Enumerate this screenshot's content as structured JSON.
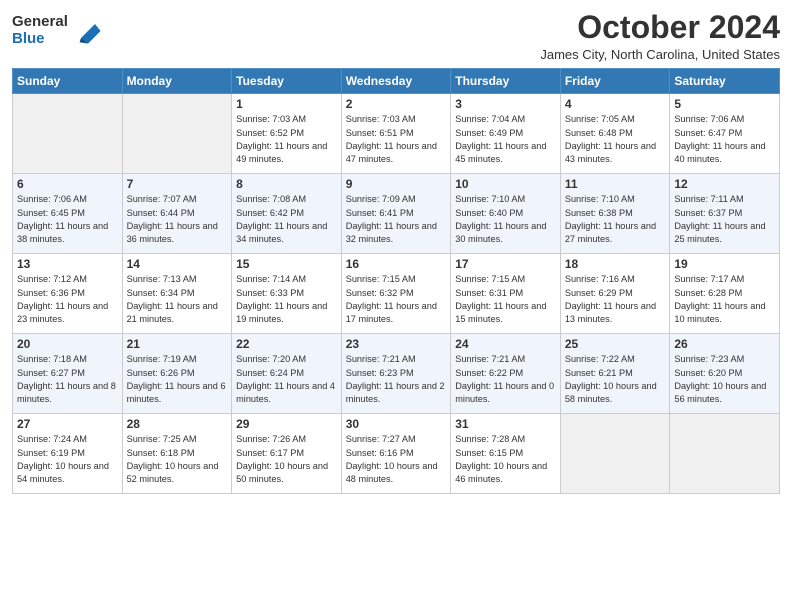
{
  "header": {
    "logo_line1": "General",
    "logo_line2": "Blue",
    "month": "October 2024",
    "location": "James City, North Carolina, United States"
  },
  "weekdays": [
    "Sunday",
    "Monday",
    "Tuesday",
    "Wednesday",
    "Thursday",
    "Friday",
    "Saturday"
  ],
  "weeks": [
    [
      {
        "day": "",
        "empty": true
      },
      {
        "day": "",
        "empty": true
      },
      {
        "day": "1",
        "sunrise": "7:03 AM",
        "sunset": "6:52 PM",
        "daylight": "11 hours and 49 minutes."
      },
      {
        "day": "2",
        "sunrise": "7:03 AM",
        "sunset": "6:51 PM",
        "daylight": "11 hours and 47 minutes."
      },
      {
        "day": "3",
        "sunrise": "7:04 AM",
        "sunset": "6:49 PM",
        "daylight": "11 hours and 45 minutes."
      },
      {
        "day": "4",
        "sunrise": "7:05 AM",
        "sunset": "6:48 PM",
        "daylight": "11 hours and 43 minutes."
      },
      {
        "day": "5",
        "sunrise": "7:06 AM",
        "sunset": "6:47 PM",
        "daylight": "11 hours and 40 minutes."
      }
    ],
    [
      {
        "day": "6",
        "sunrise": "7:06 AM",
        "sunset": "6:45 PM",
        "daylight": "11 hours and 38 minutes."
      },
      {
        "day": "7",
        "sunrise": "7:07 AM",
        "sunset": "6:44 PM",
        "daylight": "11 hours and 36 minutes."
      },
      {
        "day": "8",
        "sunrise": "7:08 AM",
        "sunset": "6:42 PM",
        "daylight": "11 hours and 34 minutes."
      },
      {
        "day": "9",
        "sunrise": "7:09 AM",
        "sunset": "6:41 PM",
        "daylight": "11 hours and 32 minutes."
      },
      {
        "day": "10",
        "sunrise": "7:10 AM",
        "sunset": "6:40 PM",
        "daylight": "11 hours and 30 minutes."
      },
      {
        "day": "11",
        "sunrise": "7:10 AM",
        "sunset": "6:38 PM",
        "daylight": "11 hours and 27 minutes."
      },
      {
        "day": "12",
        "sunrise": "7:11 AM",
        "sunset": "6:37 PM",
        "daylight": "11 hours and 25 minutes."
      }
    ],
    [
      {
        "day": "13",
        "sunrise": "7:12 AM",
        "sunset": "6:36 PM",
        "daylight": "11 hours and 23 minutes."
      },
      {
        "day": "14",
        "sunrise": "7:13 AM",
        "sunset": "6:34 PM",
        "daylight": "11 hours and 21 minutes."
      },
      {
        "day": "15",
        "sunrise": "7:14 AM",
        "sunset": "6:33 PM",
        "daylight": "11 hours and 19 minutes."
      },
      {
        "day": "16",
        "sunrise": "7:15 AM",
        "sunset": "6:32 PM",
        "daylight": "11 hours and 17 minutes."
      },
      {
        "day": "17",
        "sunrise": "7:15 AM",
        "sunset": "6:31 PM",
        "daylight": "11 hours and 15 minutes."
      },
      {
        "day": "18",
        "sunrise": "7:16 AM",
        "sunset": "6:29 PM",
        "daylight": "11 hours and 13 minutes."
      },
      {
        "day": "19",
        "sunrise": "7:17 AM",
        "sunset": "6:28 PM",
        "daylight": "11 hours and 10 minutes."
      }
    ],
    [
      {
        "day": "20",
        "sunrise": "7:18 AM",
        "sunset": "6:27 PM",
        "daylight": "11 hours and 8 minutes."
      },
      {
        "day": "21",
        "sunrise": "7:19 AM",
        "sunset": "6:26 PM",
        "daylight": "11 hours and 6 minutes."
      },
      {
        "day": "22",
        "sunrise": "7:20 AM",
        "sunset": "6:24 PM",
        "daylight": "11 hours and 4 minutes."
      },
      {
        "day": "23",
        "sunrise": "7:21 AM",
        "sunset": "6:23 PM",
        "daylight": "11 hours and 2 minutes."
      },
      {
        "day": "24",
        "sunrise": "7:21 AM",
        "sunset": "6:22 PM",
        "daylight": "11 hours and 0 minutes."
      },
      {
        "day": "25",
        "sunrise": "7:22 AM",
        "sunset": "6:21 PM",
        "daylight": "10 hours and 58 minutes."
      },
      {
        "day": "26",
        "sunrise": "7:23 AM",
        "sunset": "6:20 PM",
        "daylight": "10 hours and 56 minutes."
      }
    ],
    [
      {
        "day": "27",
        "sunrise": "7:24 AM",
        "sunset": "6:19 PM",
        "daylight": "10 hours and 54 minutes."
      },
      {
        "day": "28",
        "sunrise": "7:25 AM",
        "sunset": "6:18 PM",
        "daylight": "10 hours and 52 minutes."
      },
      {
        "day": "29",
        "sunrise": "7:26 AM",
        "sunset": "6:17 PM",
        "daylight": "10 hours and 50 minutes."
      },
      {
        "day": "30",
        "sunrise": "7:27 AM",
        "sunset": "6:16 PM",
        "daylight": "10 hours and 48 minutes."
      },
      {
        "day": "31",
        "sunrise": "7:28 AM",
        "sunset": "6:15 PM",
        "daylight": "10 hours and 46 minutes."
      },
      {
        "day": "",
        "empty": true
      },
      {
        "day": "",
        "empty": true
      }
    ]
  ],
  "labels": {
    "sunrise": "Sunrise: ",
    "sunset": "Sunset: ",
    "daylight": "Daylight: "
  }
}
